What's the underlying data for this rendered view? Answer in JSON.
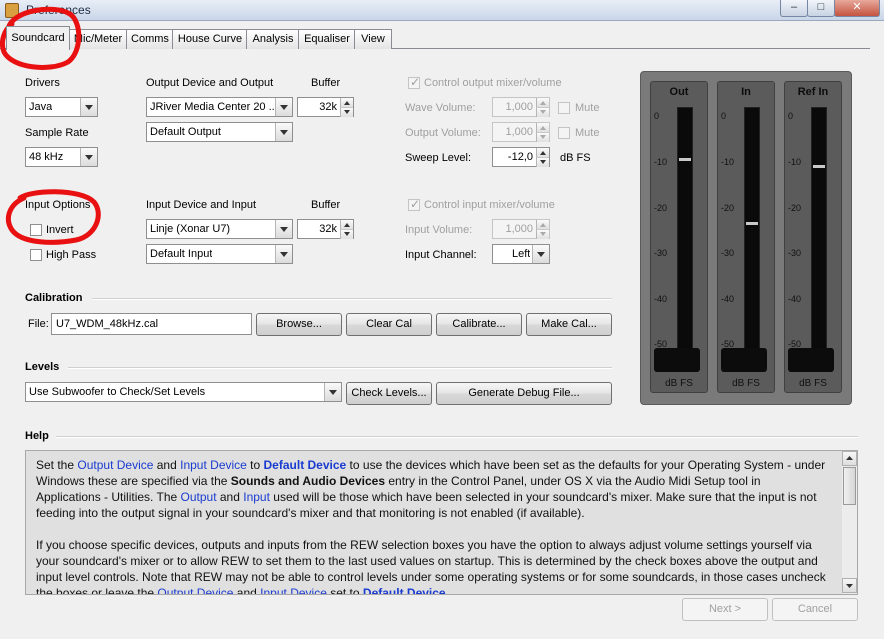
{
  "window": {
    "title": "Preferences"
  },
  "tabs": [
    "Soundcard",
    "Mic/Meter",
    "Comms",
    "House Curve",
    "Analysis",
    "Equaliser",
    "View"
  ],
  "drivers": {
    "label": "Drivers",
    "value": "Java"
  },
  "sample_rate": {
    "label": "Sample Rate",
    "value": "48 kHz"
  },
  "output": {
    "device_label": "Output Device and Output",
    "device": "JRiver Media Center 20 ...",
    "output": "Default Output",
    "buffer_label": "Buffer",
    "buffer": "32k"
  },
  "output_mixer": {
    "control_label": "Control output mixer/volume",
    "wave_label": "Wave Volume:",
    "wave_value": "1,000",
    "output_label": "Output Volume:",
    "output_value": "1,000",
    "mute_label": "Mute",
    "sweep_label": "Sweep Level:",
    "sweep_value": "-12,0",
    "sweep_unit": "dB FS"
  },
  "input_options": {
    "label": "Input Options",
    "invert": "Invert",
    "high_pass": "High Pass"
  },
  "input": {
    "device_label": "Input Device and Input",
    "device": "Linje (Xonar U7)",
    "input": "Default Input",
    "buffer_label": "Buffer",
    "buffer": "32k"
  },
  "input_mixer": {
    "control_label": "Control input mixer/volume",
    "volume_label": "Input Volume:",
    "volume_value": "1,000",
    "channel_label": "Input Channel:",
    "channel_value": "Left"
  },
  "calibration": {
    "heading": "Calibration",
    "file_label": "File:",
    "file_value": "U7_WDM_48kHz.cal",
    "browse": "Browse...",
    "clear": "Clear Cal",
    "calibrate": "Calibrate...",
    "make": "Make Cal..."
  },
  "levels": {
    "heading": "Levels",
    "mode": "Use Subwoofer to Check/Set Levels",
    "check": "Check Levels...",
    "debug": "Generate Debug File..."
  },
  "meters": {
    "ticks": [
      "0",
      "-10",
      "-20",
      "-30",
      "-40",
      "-50"
    ],
    "unit": "dB FS",
    "items": [
      {
        "name": "Out",
        "level_db": -10
      },
      {
        "name": "In",
        "level_db": -24
      },
      {
        "name": "Ref In",
        "level_db": -11.5
      }
    ]
  },
  "help": {
    "heading": "Help",
    "p1": [
      {
        "t": "Set the "
      },
      {
        "t": "Output Device",
        "s": "hl"
      },
      {
        "t": " and "
      },
      {
        "t": "Input Device",
        "s": "hl"
      },
      {
        "t": " to "
      },
      {
        "t": "Default Device",
        "s": "hlb"
      },
      {
        "t": " to use the devices which have been set as the defaults for your Operating System - under Windows these are specified via the "
      },
      {
        "t": "Sounds and Audio Devices",
        "s": "bold"
      },
      {
        "t": " entry in the Control Panel, under OS X via the Audio Midi Setup tool in Applications - Utilities. The "
      },
      {
        "t": "Output",
        "s": "hl"
      },
      {
        "t": " and "
      },
      {
        "t": "Input",
        "s": "hl"
      },
      {
        "t": " used will be those which have been selected in your soundcard's mixer. Make sure that the input is not feeding into the output signal in your soundcard's mixer and that monitoring is not enabled (if available)."
      }
    ],
    "p2": [
      {
        "t": "If you choose specific devices, outputs and inputs from the REW selection boxes you have the option to always adjust volume settings yourself via your soundcard's mixer or to allow REW to set them to the last used values on startup. This is determined by the check boxes above the output and input level controls. Note that REW may not be able to control levels under some operating systems or for some soundcards, in those cases uncheck the boxes or leave the "
      },
      {
        "t": "Output Device",
        "s": "hl"
      },
      {
        "t": " and "
      },
      {
        "t": "Input Device",
        "s": "hl"
      },
      {
        "t": " set to "
      },
      {
        "t": "Default Device",
        "s": "hlb"
      },
      {
        "t": "."
      }
    ]
  },
  "footer": {
    "next": "Next >",
    "cancel": "Cancel"
  },
  "colors": {
    "accent_link": "#1a3bd0",
    "annotation_red": "#e81010"
  }
}
